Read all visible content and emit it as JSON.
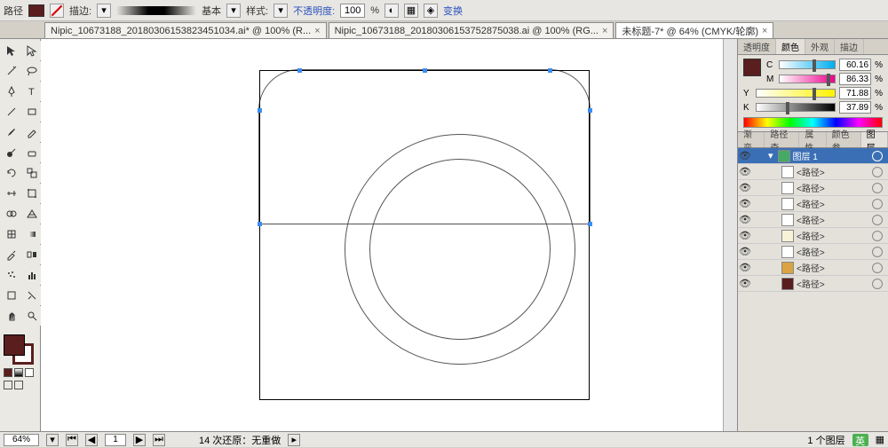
{
  "topbar": {
    "path_label": "路径",
    "stroke_label": "描边:",
    "basic_label": "基本",
    "style_label": "样式:",
    "opacity_label": "不透明度:",
    "opacity_value": "100",
    "opacity_unit": "%",
    "transform_label": "变换"
  },
  "tabs": [
    {
      "label": "Nipic_10673188_20180306153823451034.ai* @ 100% (R...",
      "close": "×"
    },
    {
      "label": "Nipic_10673188_20180306153752875038.ai @ 100% (RG...",
      "close": "×"
    },
    {
      "label": "未标题-7* @ 64% (CMYK/轮廓)",
      "close": "×"
    }
  ],
  "panel_tabs_top": {
    "transparency": "透明度",
    "color": "颜色",
    "appearance": "外观",
    "stroke": "描边"
  },
  "cmyk": {
    "c": {
      "label": "C",
      "value": "60.16"
    },
    "m": {
      "label": "M",
      "value": "86.33"
    },
    "y": {
      "label": "Y",
      "value": "71.88"
    },
    "k": {
      "label": "K",
      "value": "37.89"
    },
    "pct": "%"
  },
  "panel_tabs_mid": {
    "gradient": "渐变",
    "pathfinder": "路径查",
    "attributes": "属性",
    "color_guide": "颜色参",
    "layers": "图层"
  },
  "layers": {
    "layer1_name": "图层 1",
    "items": [
      {
        "name": "<路径>",
        "color": "#ffffff"
      },
      {
        "name": "<路径>",
        "color": "#ffffff"
      },
      {
        "name": "<路径>",
        "color": "#ffffff"
      },
      {
        "name": "<路径>",
        "color": "#ffffff"
      },
      {
        "name": "<路径>",
        "color": "#f8f3d8"
      },
      {
        "name": "<路径>",
        "color": "#ffffff"
      },
      {
        "name": "<路径>",
        "color": "#d9a441"
      },
      {
        "name": "<路径>",
        "color": "#5a1e1e"
      }
    ]
  },
  "status": {
    "zoom": "64%",
    "page": "1",
    "undo_info": "14 次还原：无重做",
    "layer_count": "1 个图层",
    "ime": "英"
  }
}
